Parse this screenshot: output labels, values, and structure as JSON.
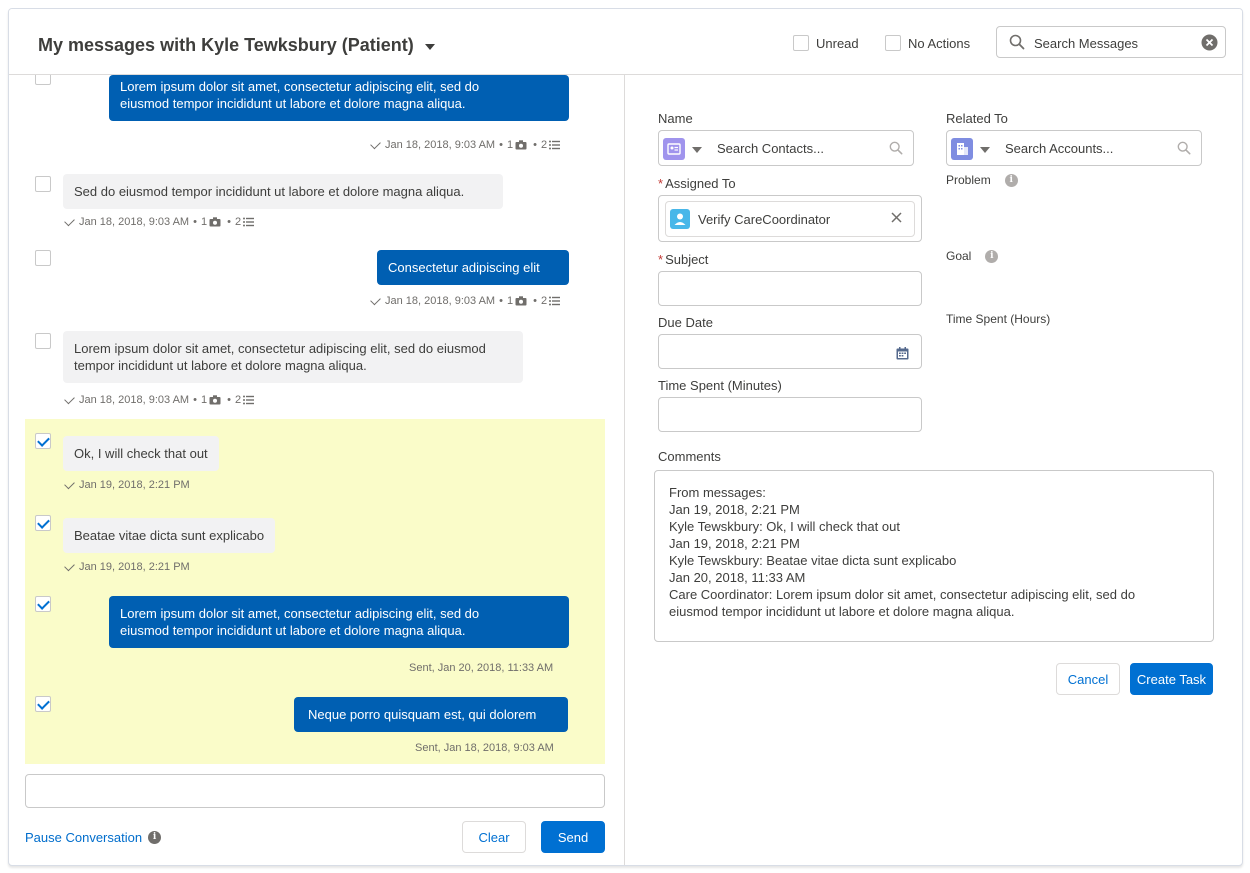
{
  "header": {
    "title": "My messages with Kyle Tewksbury (Patient)",
    "filters": [
      {
        "label": "Unread",
        "checked": false
      },
      {
        "label": "No Actions",
        "checked": false
      }
    ],
    "search": {
      "placeholder": "Search Messages"
    }
  },
  "messages": [
    {
      "direction": "out",
      "lines": [
        "Lorem ipsum dolor sit amet, consectetur adipiscing elit, sed do",
        "eiusmod tempor incididunt ut labore et dolore magna aliqua."
      ],
      "meta": {
        "time": "Jan 18, 2018, 9:03 AM",
        "attachments": "1",
        "tasks": "2"
      },
      "selected": false
    },
    {
      "direction": "in",
      "lines": [
        "Sed do eiusmod tempor incididunt ut labore et dolore magna aliqua."
      ],
      "meta": {
        "time": "Jan 18, 2018, 9:03 AM",
        "attachments": "1",
        "tasks": "2"
      },
      "selected": false
    },
    {
      "direction": "out",
      "lines": [
        "Consectetur adipiscing elit"
      ],
      "meta": {
        "time": "Jan 18, 2018, 9:03 AM",
        "attachments": "1",
        "tasks": "2"
      },
      "selected": false
    },
    {
      "direction": "in",
      "lines": [
        "Lorem ipsum dolor sit amet, consectetur adipiscing elit, sed do eiusmod",
        "tempor incididunt ut labore et dolore magna aliqua."
      ],
      "meta": {
        "time": "Jan 18, 2018, 9:03 AM",
        "attachments": "1",
        "tasks": "2"
      },
      "selected": false
    },
    {
      "direction": "in",
      "lines": [
        "Ok, I will check that out"
      ],
      "meta": {
        "time": "Jan 19, 2018, 2:21 PM"
      },
      "selected": true
    },
    {
      "direction": "in",
      "lines": [
        "Beatae vitae dicta sunt explicabo"
      ],
      "meta": {
        "time": "Jan 19, 2018, 2:21 PM"
      },
      "selected": true
    },
    {
      "direction": "out",
      "lines": [
        "Lorem ipsum dolor sit amet, consectetur adipiscing elit, sed do",
        "eiusmod tempor incididunt ut labore et dolore magna aliqua."
      ],
      "meta": {
        "time": "Sent, Jan 20, 2018, 11:33 AM"
      },
      "selected": true
    },
    {
      "direction": "out",
      "lines": [
        "Neque porro quisquam est, qui dolorem"
      ],
      "meta": {
        "time": "Sent, Jan 18, 2018, 9:03 AM"
      },
      "selected": true
    }
  ],
  "composer": {
    "value": "",
    "pause_label": "Pause Conversation",
    "clear_label": "Clear",
    "send_label": "Send"
  },
  "task_form": {
    "name": {
      "label": "Name",
      "placeholder": "Search Contacts..."
    },
    "related_to": {
      "label": "Related To",
      "placeholder": "Search Accounts..."
    },
    "assigned_to": {
      "label": "Assigned To",
      "value": "Verify CareCoordinator"
    },
    "subject": {
      "label": "Subject",
      "value": ""
    },
    "due_date": {
      "label": "Due Date",
      "value": ""
    },
    "time_spent_minutes": {
      "label": "Time Spent (Minutes)",
      "value": ""
    },
    "problem": {
      "label": "Problem"
    },
    "goal": {
      "label": "Goal"
    },
    "time_spent_hours": {
      "label": "Time Spent (Hours)"
    },
    "comments": {
      "label": "Comments",
      "lines": [
        "From messages:",
        "Jan 19, 2018, 2:21 PM",
        "Kyle Tewskbury: Ok, I will check that out",
        "Jan 19, 2018, 2:21 PM",
        "Kyle Tewskbury: Beatae vitae dicta sunt explicabo",
        "Jan 20, 2018, 11:33 AM",
        "Care Coordinator: Lorem ipsum dolor sit amet, consectetur adipiscing elit, sed do",
        "eiusmod tempor incididunt ut labore et dolore magna aliqua."
      ]
    },
    "cancel_label": "Cancel",
    "create_label": "Create Task"
  },
  "icons": {
    "contact": "contact-card-icon",
    "account": "account-building-icon",
    "user": "user-icon",
    "calendar": "calendar-icon",
    "search": "search-icon",
    "info": "info-icon"
  },
  "colors": {
    "brand": "#0070d2",
    "outgoing_bubble": "#005fb2",
    "incoming_bubble": "#f2f2f3",
    "selection_highlight": "#fafcc9",
    "required": "#c23934",
    "contact_icon": "#a094ed",
    "account_icon": "#7f8de1",
    "user_icon": "#48b7e9"
  }
}
